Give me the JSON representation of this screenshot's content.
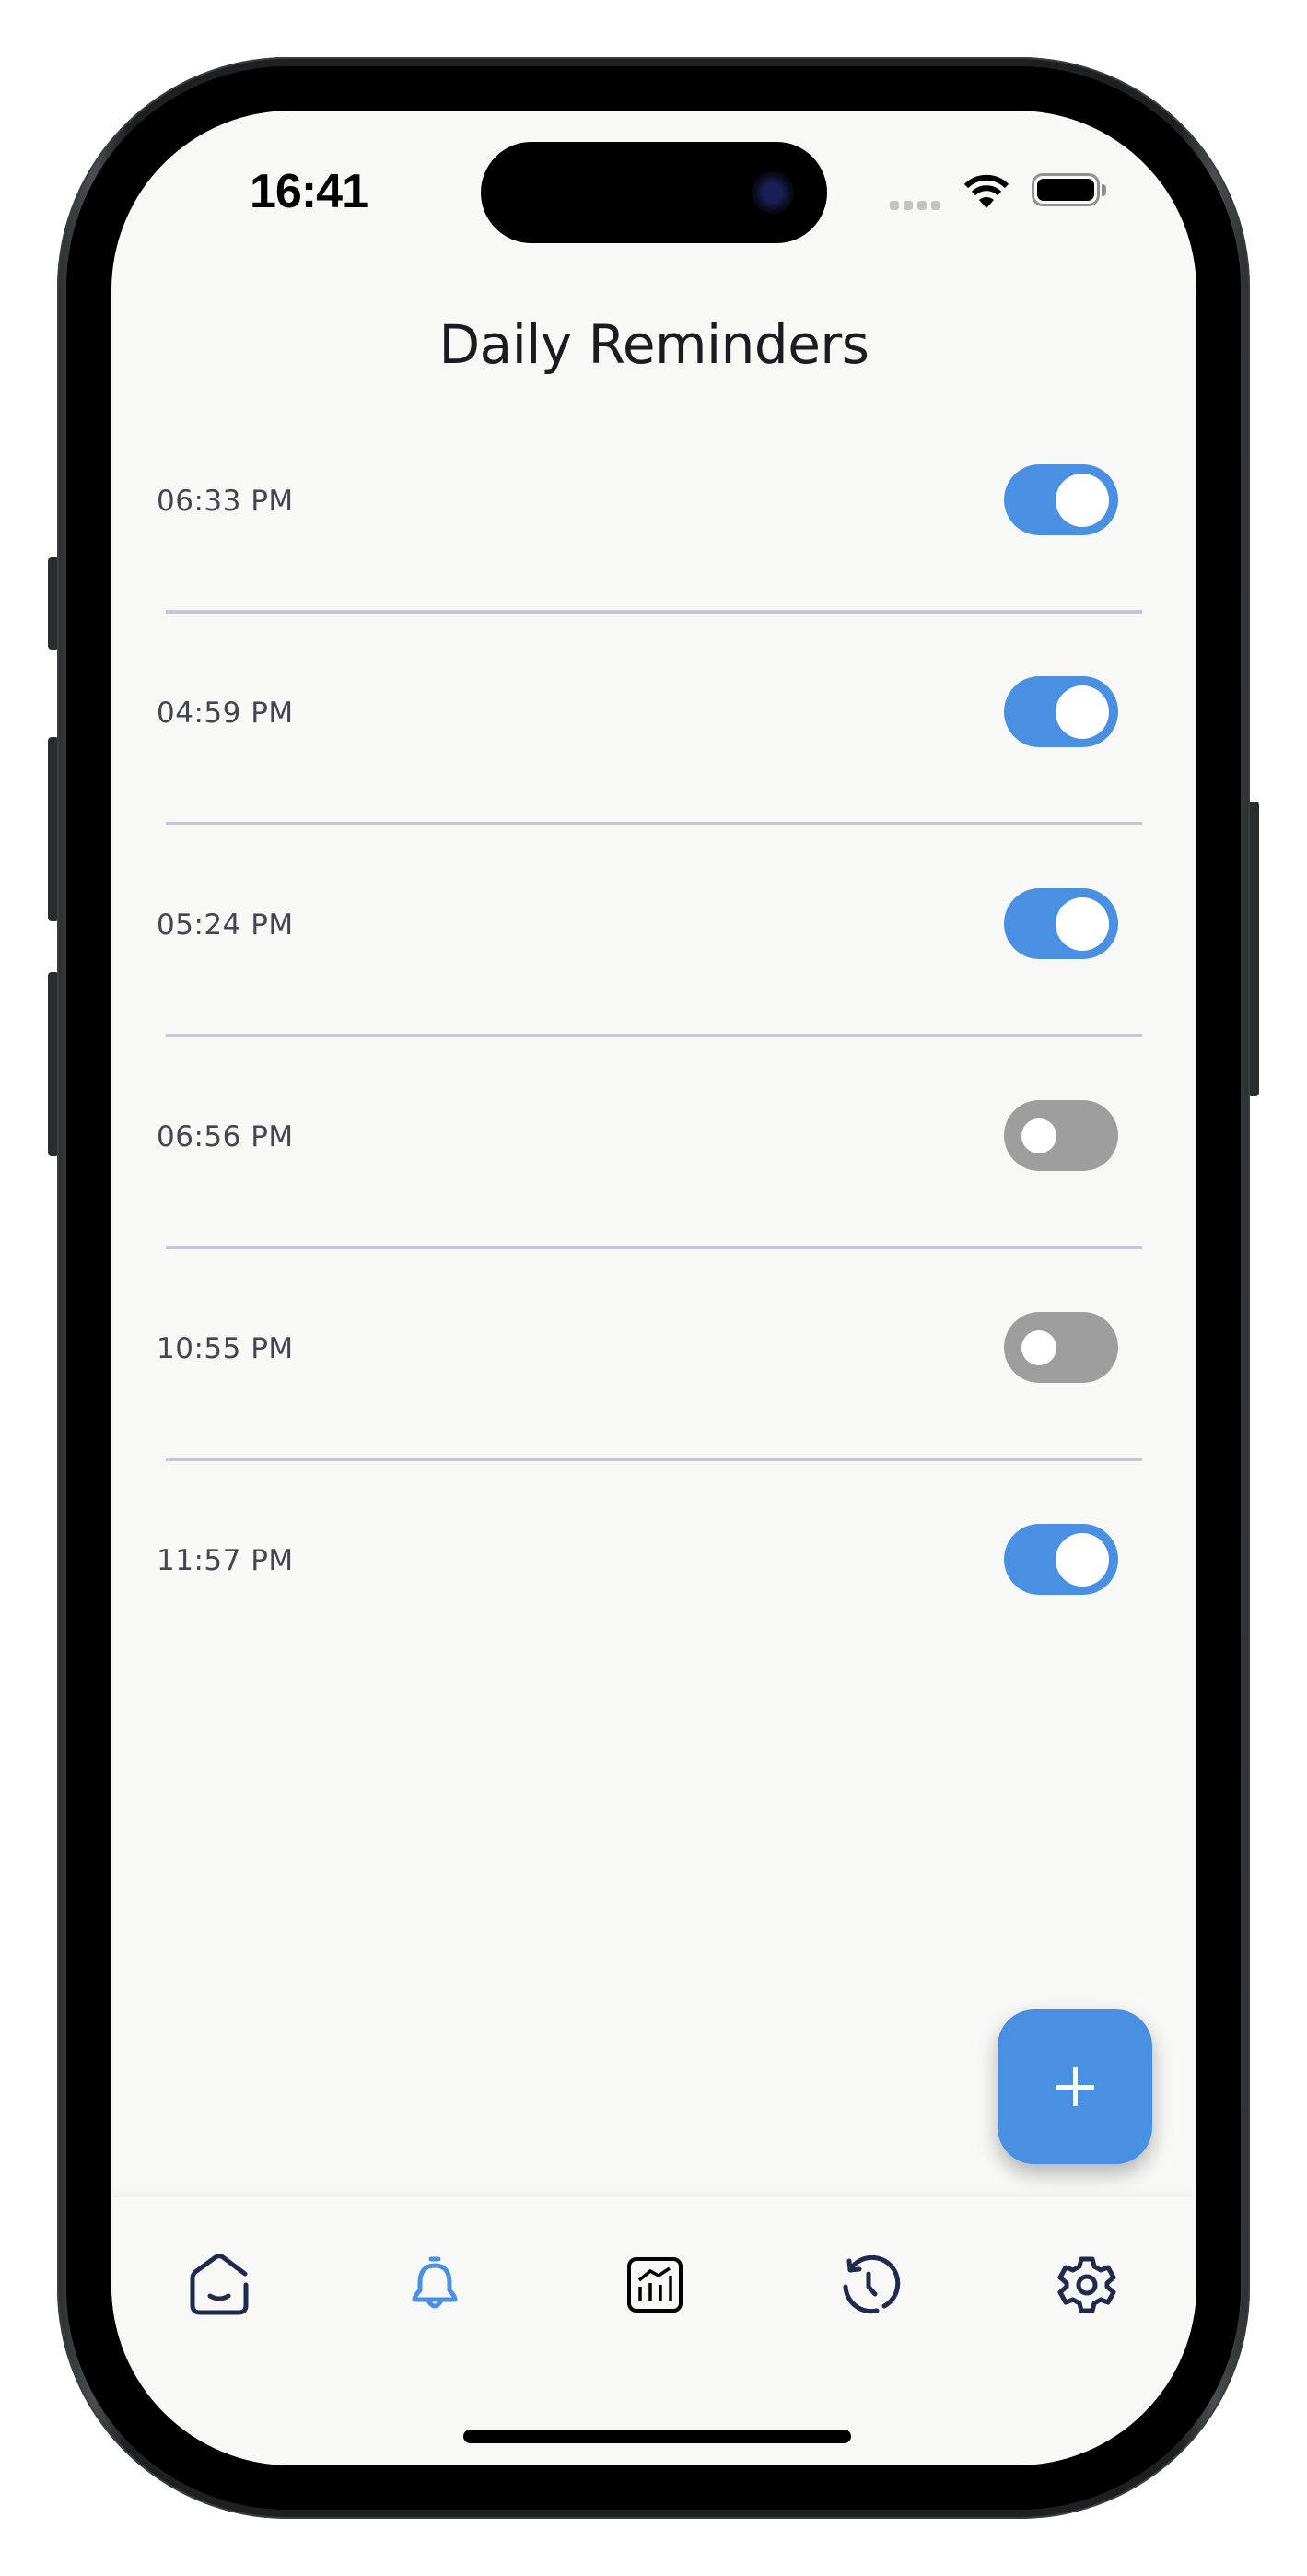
{
  "status_bar": {
    "time": "16:41"
  },
  "header": {
    "title": "Daily Reminders"
  },
  "reminders": [
    {
      "time": "06:33 PM",
      "enabled": true
    },
    {
      "time": "04:59 PM",
      "enabled": true
    },
    {
      "time": "05:24 PM",
      "enabled": true
    },
    {
      "time": "06:56 PM",
      "enabled": false
    },
    {
      "time": "10:55 PM",
      "enabled": false
    },
    {
      "time": "11:57 PM",
      "enabled": true
    }
  ],
  "fab": {
    "icon": "plus-icon"
  },
  "bottom_nav": {
    "active_index": 1,
    "items": [
      {
        "icon": "home-icon"
      },
      {
        "icon": "bell-icon"
      },
      {
        "icon": "chart-icon"
      },
      {
        "icon": "history-icon"
      },
      {
        "icon": "settings-icon"
      }
    ]
  },
  "colors": {
    "accent": "#4a90e2",
    "toggle_off": "#9e9e9e",
    "nav_icon": "#1f2a4e",
    "divider": "#c8c5d0",
    "background": "#f8f8f6"
  }
}
